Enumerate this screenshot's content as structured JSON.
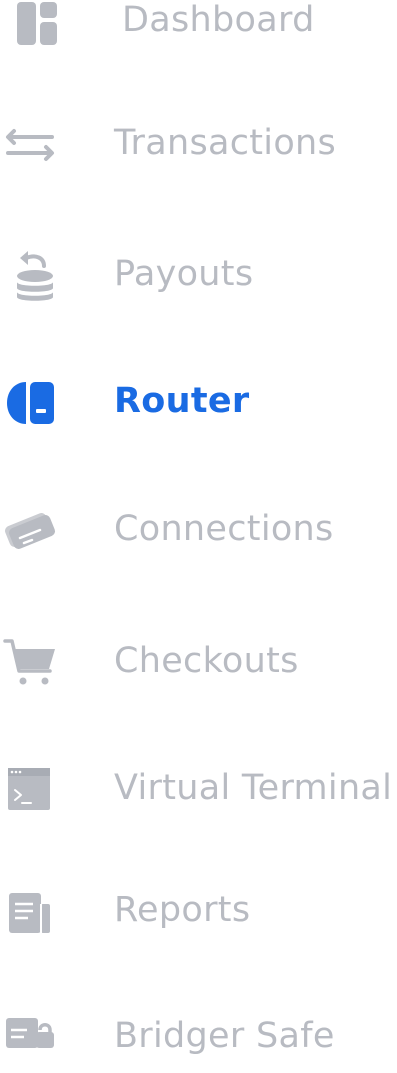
{
  "colors": {
    "inactive": "#b8bbc2",
    "active": "#1a6be3"
  },
  "nav": {
    "items": [
      {
        "label": "Dashboard",
        "icon": "dashboard-icon",
        "active": false
      },
      {
        "label": "Transactions",
        "icon": "transfer-arrows-icon",
        "active": false
      },
      {
        "label": "Payouts",
        "icon": "coin-stack-icon",
        "active": false
      },
      {
        "label": "Router",
        "icon": "router-icon",
        "active": true
      },
      {
        "label": "Connections",
        "icon": "card-link-icon",
        "active": false
      },
      {
        "label": "Checkouts",
        "icon": "shopping-cart-icon",
        "active": false
      },
      {
        "label": "Virtual Terminal",
        "icon": "terminal-icon",
        "active": false
      },
      {
        "label": "Reports",
        "icon": "report-document-icon",
        "active": false
      },
      {
        "label": "Bridger Safe",
        "icon": "safe-lock-icon",
        "active": false
      }
    ]
  }
}
